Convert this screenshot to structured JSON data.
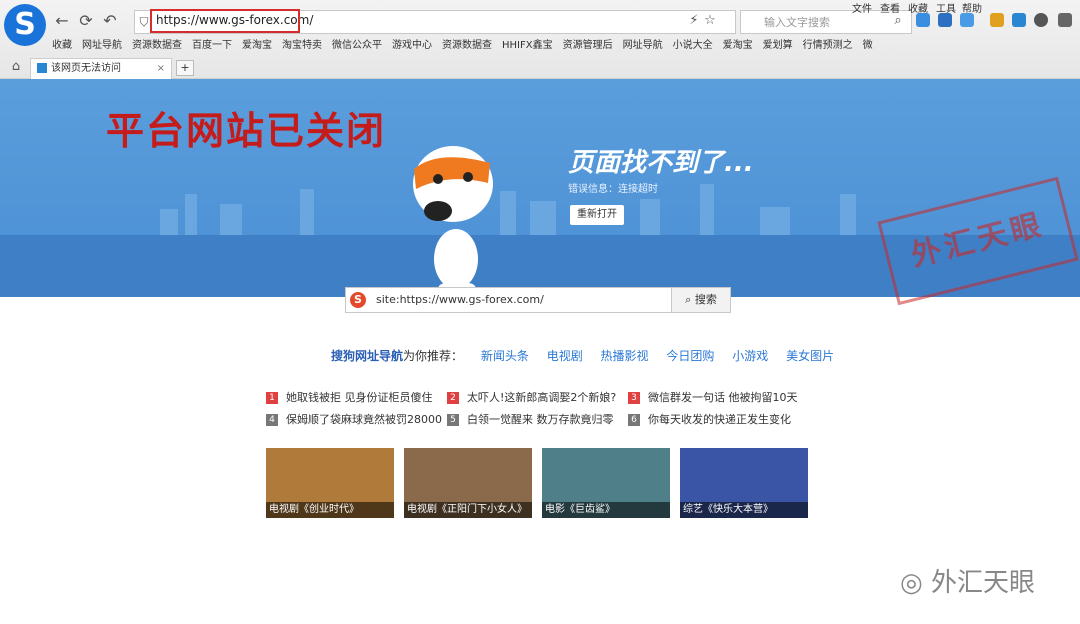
{
  "browser": {
    "url": "https://www.gs-forex.com/",
    "search_placeholder": "输入文字搜索",
    "menu": [
      "文件",
      "查看",
      "收藏",
      "工具",
      "帮助"
    ],
    "bookmarks": [
      "收藏",
      "网址导航",
      "资源数据查",
      "百度一下",
      "爱淘宝",
      "淘宝特卖",
      "微信公众平",
      "游戏中心",
      "资源数据查",
      "HHIFX鑫宝",
      "资源管理后",
      "网址导航",
      "小说大全",
      "爱淘宝",
      "爱划算",
      "行情预测之",
      "微"
    ],
    "tab_title": "该网页无法访问",
    "new_tab": "+"
  },
  "hero": {
    "overlay_title": "平台网站已关闭",
    "title": "页面找不到了...",
    "error": "错误信息：连接超时",
    "retry_label": "重新打开",
    "stamp": "外汇天眼"
  },
  "search": {
    "value": "site:https://www.gs-forex.com/",
    "button": "搜索"
  },
  "recommend": {
    "brand": "搜狗网址导航",
    "suffix": "为你推荐：",
    "links": [
      "新闻头条",
      "电视剧",
      "热播影视",
      "今日团购",
      "小游戏",
      "美女图片"
    ]
  },
  "news": [
    {
      "n": "1",
      "text": "她取钱被拒 见身份证柜员傻住"
    },
    {
      "n": "2",
      "text": "太吓人!这新郎高调娶2个新娘?"
    },
    {
      "n": "3",
      "text": "微信群发一句话 他被拘留10天"
    },
    {
      "n": "4",
      "text": "保姆顺了袋麻球竟然被罚28000"
    },
    {
      "n": "5",
      "text": "白领一觉醒来 数万存款竟归零"
    },
    {
      "n": "6",
      "text": "你每天收发的快递正发生变化"
    }
  ],
  "thumbs": [
    {
      "caption": "电视剧《创业时代》",
      "color": "#b07a3a"
    },
    {
      "caption": "电视剧《正阳门下小女人》",
      "color": "#8a6a4a"
    },
    {
      "caption": "电影《巨齿鲨》",
      "color": "#4f7f88"
    },
    {
      "caption": "综艺《快乐大本营》",
      "color": "#3a55a5"
    }
  ],
  "watermark": "外汇天眼"
}
